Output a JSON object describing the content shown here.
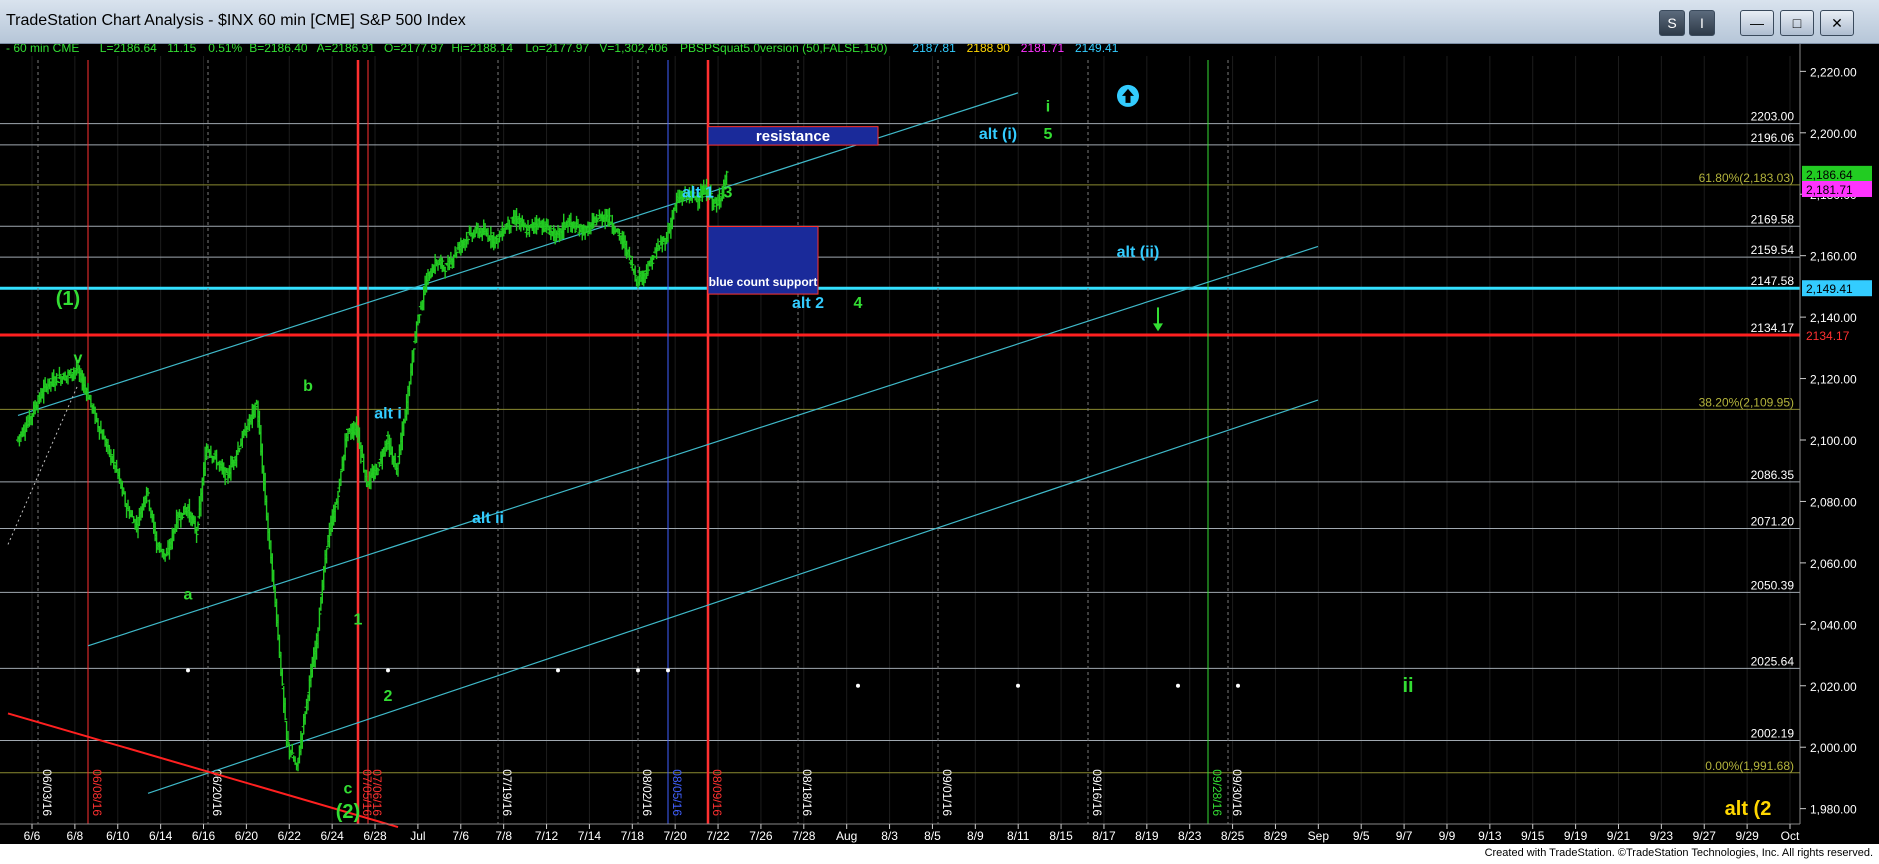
{
  "window": {
    "title": "TradeStation Chart Analysis - $INX 60 min [CME] S&P 500 Index",
    "btn_s": "S",
    "btn_i": "I",
    "btn_min": "—",
    "btn_max": "□",
    "btn_close": "✕"
  },
  "footer": {
    "text": "Created with TradeStation. ©TradeStation Technologies, Inc. All rights reserved."
  },
  "colors": {
    "background": "#000000",
    "candles": "#22cc22",
    "channel": "#3fb9c9",
    "red_line": "#ff2020",
    "cyan_line": "#33e0ff"
  },
  "info_bar": [
    {
      "text": "- 60 min  CME",
      "color": "#33dd33"
    },
    {
      "text": "L=2186.64",
      "color": "#33dd33"
    },
    {
      "text": "11.15",
      "color": "#33dd33"
    },
    {
      "text": "0.51%",
      "color": "#33dd33"
    },
    {
      "text": "B=2186.40",
      "color": "#33dd33"
    },
    {
      "text": "A=2186.91",
      "color": "#33dd33"
    },
    {
      "text": "O=2177.97",
      "color": "#33dd33"
    },
    {
      "text": "Hi=2188.14",
      "color": "#33dd33"
    },
    {
      "text": "Lo=2177.97",
      "color": "#33dd33"
    },
    {
      "text": "V=1,302,406",
      "color": "#33dd33"
    },
    {
      "text": "PBSPSquat5.0version (50,FALSE,150)",
      "color": "#33dd33"
    },
    {
      "text": "2187.81",
      "color": "#33ccff"
    },
    {
      "text": "2188.90",
      "color": "#ffd700"
    },
    {
      "text": "2181.71",
      "color": "#ff33ff"
    },
    {
      "text": "2149.41",
      "color": "#33ccff"
    }
  ],
  "chart_data": {
    "type": "candlestick",
    "interval": "60 min",
    "ylim": [
      1975,
      2225
    ],
    "y_ticks": [
      1980,
      2000,
      2020,
      2040,
      2060,
      2080,
      2100,
      2120,
      2140,
      2160,
      2180,
      2200,
      2220
    ],
    "y_tick_labels": [
      "1,980.00",
      "2,000.00",
      "2,020.00",
      "2,040.00",
      "2,060.00",
      "2,080.00",
      "2,100.00",
      "2,120.00",
      "2,140.00",
      "2,160.00",
      "2,180.00",
      "2,200.00",
      "2,220.00"
    ],
    "x_labels": [
      "6/6",
      "6/8",
      "6/10",
      "6/14",
      "6/16",
      "6/20",
      "6/22",
      "6/24",
      "6/28",
      "Jul",
      "7/6",
      "7/8",
      "7/12",
      "7/14",
      "7/18",
      "7/20",
      "7/22",
      "7/26",
      "7/28",
      "Aug",
      "8/3",
      "8/5",
      "8/9",
      "8/11",
      "8/15",
      "8/17",
      "8/19",
      "8/23",
      "8/25",
      "8/29",
      "Sep",
      "9/5",
      "9/7",
      "9/9",
      "9/13",
      "9/15",
      "9/19",
      "9/21",
      "9/23",
      "9/27",
      "9/29",
      "Oct"
    ],
    "vertical_dates": [
      {
        "text": "06/03/16",
        "color": "#ffffff",
        "day": 3
      },
      {
        "text": "06/08/16",
        "color": "#ff3030",
        "day": 8
      },
      {
        "text": "06/20/16",
        "color": "#ffffff",
        "day": 20
      },
      {
        "text": "07/05/16",
        "color": "#ff3030",
        "day": 35
      },
      {
        "text": "07/06/16",
        "color": "#ff3030",
        "day": 36
      },
      {
        "text": "07/19/16",
        "color": "#ffffff",
        "day": 49
      },
      {
        "text": "08/02/16",
        "color": "#ffffff",
        "day": 63
      },
      {
        "text": "08/05/16",
        "color": "#4060ff",
        "day": 66
      },
      {
        "text": "08/09/16",
        "color": "#ff3030",
        "day": 70
      },
      {
        "text": "08/18/16",
        "color": "#ffffff",
        "day": 79
      },
      {
        "text": "09/01/16",
        "color": "#ffffff",
        "day": 93
      },
      {
        "text": "09/16/16",
        "color": "#ffffff",
        "day": 108
      },
      {
        "text": "09/28/16",
        "color": "#33dd33",
        "day": 120
      },
      {
        "text": "09/30/16",
        "color": "#ffffff",
        "day": 122
      }
    ],
    "price_path": [
      [
        1,
        2100
      ],
      [
        2,
        2105
      ],
      [
        3,
        2112
      ],
      [
        4,
        2118
      ],
      [
        5,
        2120
      ],
      [
        6,
        2121
      ],
      [
        7,
        2123
      ],
      [
        8,
        2116
      ],
      [
        9,
        2106
      ],
      [
        10,
        2098
      ],
      [
        11,
        2090
      ],
      [
        12,
        2078
      ],
      [
        13,
        2072
      ],
      [
        14,
        2084
      ],
      [
        15,
        2066
      ],
      [
        16,
        2062
      ],
      [
        17,
        2074
      ],
      [
        18,
        2078
      ],
      [
        19,
        2070
      ],
      [
        20,
        2098
      ],
      [
        21,
        2093
      ],
      [
        22,
        2088
      ],
      [
        23,
        2096
      ],
      [
        24,
        2104
      ],
      [
        25,
        2112
      ],
      [
        26,
        2075
      ],
      [
        27,
        2042
      ],
      [
        28,
        2002
      ],
      [
        29,
        1993
      ],
      [
        30,
        2015
      ],
      [
        31,
        2035
      ],
      [
        32,
        2066
      ],
      [
        33,
        2080
      ],
      [
        34,
        2102
      ],
      [
        35,
        2104
      ],
      [
        36,
        2086
      ],
      [
        37,
        2090
      ],
      [
        38,
        2100
      ],
      [
        39,
        2090
      ],
      [
        40,
        2112
      ],
      [
        41,
        2138
      ],
      [
        42,
        2152
      ],
      [
        43,
        2158
      ],
      [
        44,
        2156
      ],
      [
        45,
        2162
      ],
      [
        46,
        2166
      ],
      [
        47,
        2168
      ],
      [
        48,
        2167
      ],
      [
        49,
        2165
      ],
      [
        50,
        2170
      ],
      [
        51,
        2172
      ],
      [
        52,
        2168
      ],
      [
        53,
        2171
      ],
      [
        54,
        2169
      ],
      [
        55,
        2166
      ],
      [
        56,
        2171
      ],
      [
        57,
        2169
      ],
      [
        58,
        2168
      ],
      [
        59,
        2172
      ],
      [
        60,
        2173
      ],
      [
        61,
        2168
      ],
      [
        62,
        2162
      ],
      [
        63,
        2152
      ],
      [
        64,
        2155
      ],
      [
        65,
        2162
      ],
      [
        66,
        2166
      ],
      [
        67,
        2178
      ],
      [
        68,
        2180
      ],
      [
        69,
        2179
      ],
      [
        70,
        2181
      ],
      [
        71,
        2176
      ],
      [
        72,
        2186
      ]
    ],
    "horizontal_levels": [
      {
        "value": 2203.0,
        "label": "2203.00",
        "color": "#a0a8b0",
        "width": 1
      },
      {
        "value": 2196.06,
        "label": "2196.06",
        "color": "#a0a8b0",
        "width": 1
      },
      {
        "value": 2183.03,
        "label": "61.80%(2,183.03)",
        "color": "#8a8a30",
        "width": 1
      },
      {
        "value": 2169.58,
        "label": "2169.58",
        "color": "#a0a8b0",
        "width": 1
      },
      {
        "value": 2159.54,
        "label": "2159.54",
        "color": "#a0a8b0",
        "width": 1
      },
      {
        "value": 2149.41,
        "label": "2147.58",
        "color": "#33e0ff",
        "width": 3
      },
      {
        "value": 2134.17,
        "label": "2134.17",
        "color": "#ff2020",
        "width": 3
      },
      {
        "value": 2109.95,
        "label": "38.20%(2,109.95)",
        "color": "#8a8a30",
        "width": 1
      },
      {
        "value": 2086.35,
        "label": "2086.35",
        "color": "#a0a8b0",
        "width": 1
      },
      {
        "value": 2071.2,
        "label": "2071.20",
        "color": "#a0a8b0",
        "width": 1
      },
      {
        "value": 2050.39,
        "label": "2050.39",
        "color": "#a0a8b0",
        "width": 1
      },
      {
        "value": 2025.64,
        "label": "2025.64",
        "color": "#a0a8b0",
        "width": 1
      },
      {
        "value": 2002.19,
        "label": "2002.19",
        "color": "#a0a8b0",
        "width": 1
      },
      {
        "value": 1991.68,
        "label": "0.00%(1,991.68)",
        "color": "#8a8a30",
        "width": 1
      }
    ],
    "price_tags": [
      {
        "value": 2186.64,
        "label": "2,186.64",
        "bg": "#22cc22",
        "fg": "#000000"
      },
      {
        "value": 2181.71,
        "label": "2,181.71",
        "bg": "#ff33ff",
        "fg": "#000000"
      },
      {
        "value": 2149.41,
        "label": "2,149.41",
        "bg": "#33ccff",
        "fg": "#000000"
      },
      {
        "value": 2134.17,
        "label": "2134.17",
        "bg": "#000000",
        "fg": "#ff3030"
      }
    ],
    "channel_lines": [
      [
        [
          1,
          2108
        ],
        [
          101,
          2213
        ]
      ],
      [
        [
          8,
          2033
        ],
        [
          131,
          2163
        ]
      ],
      [
        [
          14,
          1985
        ],
        [
          131,
          2113
        ]
      ]
    ],
    "red_trend_line": [
      [
        0,
        2011
      ],
      [
        39,
        1974
      ]
    ],
    "dotted_line": [
      [
        0,
        2066
      ],
      [
        7,
        2118
      ]
    ],
    "dots": [
      [
        18,
        2025
      ],
      [
        38,
        2025
      ],
      [
        55,
        2025
      ],
      [
        63,
        2025
      ],
      [
        66,
        2025
      ],
      [
        85,
        2020
      ],
      [
        101,
        2020
      ],
      [
        117,
        2020
      ],
      [
        123,
        2020
      ]
    ],
    "boxes": [
      {
        "x0": 70,
        "x1": 87,
        "y0": 2196,
        "y1": 2202,
        "fill": "#1a2a9a",
        "border": "#ff3333",
        "label": "resistance",
        "label_color": "#ffffff"
      },
      {
        "x0": 70,
        "x1": 81,
        "y0": 2147.5,
        "y1": 2169.5,
        "fill": "#1a2a9a",
        "border": "#ff3333",
        "label": "blue count support",
        "label_color": "#ffffff"
      }
    ],
    "annotations": [
      {
        "text": "(1)",
        "day": 6,
        "value": 2144,
        "color": "#33dd33"
      },
      {
        "text": "v",
        "day": 7,
        "value": 2125,
        "color": "#33dd33"
      },
      {
        "text": "a",
        "day": 18,
        "value": 2048,
        "color": "#33dd33"
      },
      {
        "text": "b",
        "day": 30,
        "value": 2116,
        "color": "#33dd33"
      },
      {
        "text": "alt i",
        "day": 38,
        "value": 2107,
        "color": "#33ccff"
      },
      {
        "text": "alt ii",
        "day": 48,
        "value": 2073,
        "color": "#33ccff"
      },
      {
        "text": "1",
        "day": 35,
        "value": 2040,
        "color": "#33dd33"
      },
      {
        "text": "2",
        "day": 38,
        "value": 2015,
        "color": "#33dd33"
      },
      {
        "text": "c",
        "day": 34,
        "value": 1985,
        "color": "#33dd33"
      },
      {
        "text": "(2)",
        "day": 34,
        "value": 1977,
        "color": "#33dd33"
      },
      {
        "text": "alt 1",
        "day": 69,
        "value": 2179,
        "color": "#33ccff"
      },
      {
        "text": "3",
        "day": 72,
        "value": 2179,
        "color": "#33dd33"
      },
      {
        "text": "alt 2",
        "day": 80,
        "value": 2143,
        "color": "#33ccff"
      },
      {
        "text": "4",
        "day": 85,
        "value": 2143,
        "color": "#33dd33"
      },
      {
        "text": "alt (i)",
        "day": 99,
        "value": 2198,
        "color": "#33ccff"
      },
      {
        "text": "5",
        "day": 104,
        "value": 2198,
        "color": "#33dd33"
      },
      {
        "text": "i",
        "day": 104,
        "value": 2207,
        "color": "#33dd33"
      },
      {
        "text": "alt (ii)",
        "day": 113,
        "value": 2159.5,
        "color": "#33ccff"
      },
      {
        "text": "ii",
        "day": 140,
        "value": 2018,
        "color": "#33dd33"
      },
      {
        "text": "alt (2",
        "day": 174,
        "value": 1978,
        "color": "#ffd700"
      }
    ],
    "arrows": [
      {
        "type": "up-circle",
        "day": 112,
        "value": 2212,
        "color": "#33ccff"
      },
      {
        "type": "down",
        "day": 115,
        "value": 2136,
        "color": "#33dd33"
      }
    ]
  }
}
